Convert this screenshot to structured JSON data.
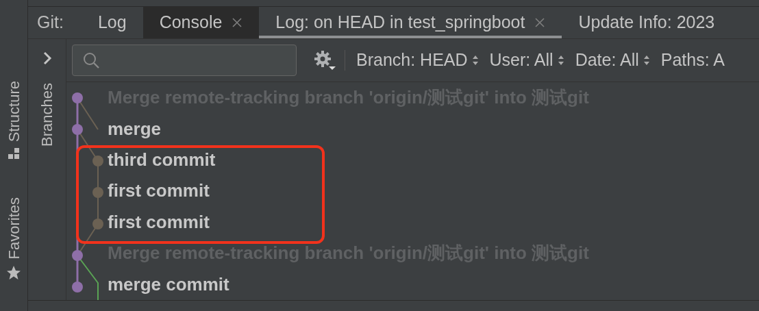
{
  "tool_stripe": [
    {
      "label": "Structure"
    },
    {
      "label": "Favorites"
    }
  ],
  "tabs_label": "Git:",
  "tabs": [
    {
      "label": "Log",
      "selected": false,
      "hovered": false,
      "closable": false
    },
    {
      "label": "Console",
      "selected": false,
      "hovered": true,
      "closable": true
    },
    {
      "label": "Log: on HEAD in test_springboot",
      "selected": true,
      "hovered": false,
      "closable": true
    },
    {
      "label": "Update Info: 2023",
      "selected": false,
      "hovered": false,
      "closable": false
    }
  ],
  "branches_panel": {
    "label": "Branches",
    "expanded": false
  },
  "filters": [
    {
      "label": "Branch: HEAD"
    },
    {
      "label": "User: All"
    },
    {
      "label": "Date: All"
    },
    {
      "label": "Paths: A"
    }
  ],
  "commits": [
    {
      "message": "Merge remote-tracking branch 'origin/测试git' into 测试git",
      "kind": "merge",
      "color": "#8e6fa8"
    },
    {
      "message": "merge",
      "kind": "commit",
      "color": "#8e6fa8"
    },
    {
      "message": "third commit",
      "kind": "side",
      "color": "#6b6153"
    },
    {
      "message": "first commit",
      "kind": "side",
      "color": "#6b6153"
    },
    {
      "message": "first commit",
      "kind": "side",
      "color": "#6b6153"
    },
    {
      "message": "Merge remote-tracking branch 'origin/测试git' into 测试git",
      "kind": "merge",
      "color": "#8e6fa8"
    },
    {
      "message": "merge commit",
      "kind": "commit",
      "color": "#8e6fa8"
    }
  ]
}
